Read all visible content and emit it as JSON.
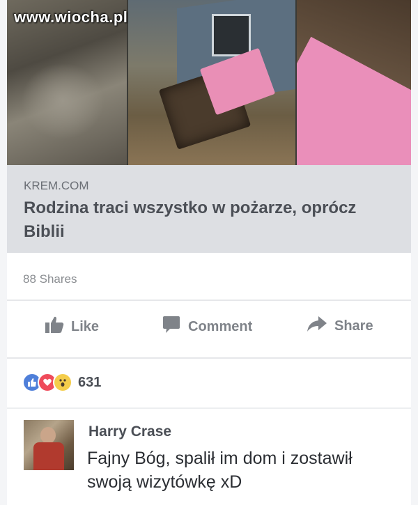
{
  "watermark": "www.wiocha.pl",
  "link": {
    "domain": "KREM.COM",
    "headline": "Rodzina traci wszystko w pożarze, oprócz Biblii"
  },
  "post": {
    "shares": "88 Shares",
    "actions": {
      "like": "Like",
      "comment": "Comment",
      "share": "Share"
    },
    "reactions": {
      "types": [
        "like",
        "love",
        "wow"
      ],
      "count": "631"
    }
  },
  "comment": {
    "author": "Harry Crase",
    "text": "Fajny Bóg, spalił im dom i zostawił swoją wizytówkę xD"
  },
  "colors": {
    "link_bg": "#dddfe3",
    "action_gray": "#7f8389",
    "like_blue": "#4f7fd9",
    "love_red": "#ef4b5b",
    "wow_yellow": "#f4cd4b",
    "bible_pink": "#e98fb6"
  },
  "icons": [
    "thumbs-up-icon",
    "comment-bubble-icon",
    "share-arrow-icon",
    "like-reaction-icon",
    "love-reaction-icon",
    "wow-reaction-icon"
  ]
}
